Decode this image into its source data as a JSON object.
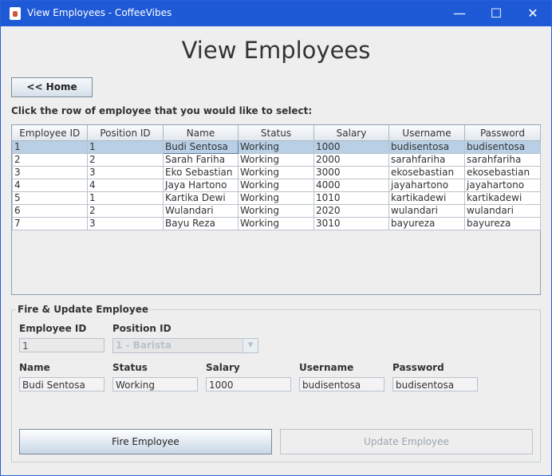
{
  "window": {
    "title": "View Employees - CoffeeVibes"
  },
  "heading": "View Employees",
  "home_button": "<< Home",
  "instruction": "Click the row of employee that you would like to select:",
  "table": {
    "columns": [
      "Employee ID",
      "Position ID",
      "Name",
      "Status",
      "Salary",
      "Username",
      "Password"
    ],
    "rows": [
      [
        "1",
        "1",
        "Budi Sentosa",
        "Working",
        "1000",
        "budisentosa",
        "budisentosa"
      ],
      [
        "2",
        "2",
        "Sarah Fariha",
        "Working",
        "2000",
        "sarahfariha",
        "sarahfariha"
      ],
      [
        "3",
        "3",
        "Eko Sebastian",
        "Working",
        "3000",
        "ekosebastian",
        "ekosebastian"
      ],
      [
        "4",
        "4",
        "Jaya Hartono",
        "Working",
        "4000",
        "jayahartono",
        "jayahartono"
      ],
      [
        "5",
        "1",
        "Kartika Dewi",
        "Working",
        "1010",
        "kartikadewi",
        "kartikadewi"
      ],
      [
        "6",
        "2",
        "Wulandari",
        "Working",
        "2020",
        "wulandari",
        "wulandari"
      ],
      [
        "7",
        "3",
        "Bayu Reza",
        "Working",
        "3010",
        "bayureza",
        "bayureza"
      ]
    ]
  },
  "form": {
    "group_title": "Fire & Update Employee",
    "employee_id_label": "Employee ID",
    "employee_id_value": "1",
    "position_id_label": "Position ID",
    "position_id_value": "1 - Barista",
    "name_label": "Name",
    "name_value": "Budi Sentosa",
    "status_label": "Status",
    "status_value": "Working",
    "salary_label": "Salary",
    "salary_value": "1000",
    "username_label": "Username",
    "username_value": "budisentosa",
    "password_label": "Password",
    "password_value": "budisentosa",
    "fire_button": "Fire Employee",
    "update_button": "Update Employee"
  }
}
